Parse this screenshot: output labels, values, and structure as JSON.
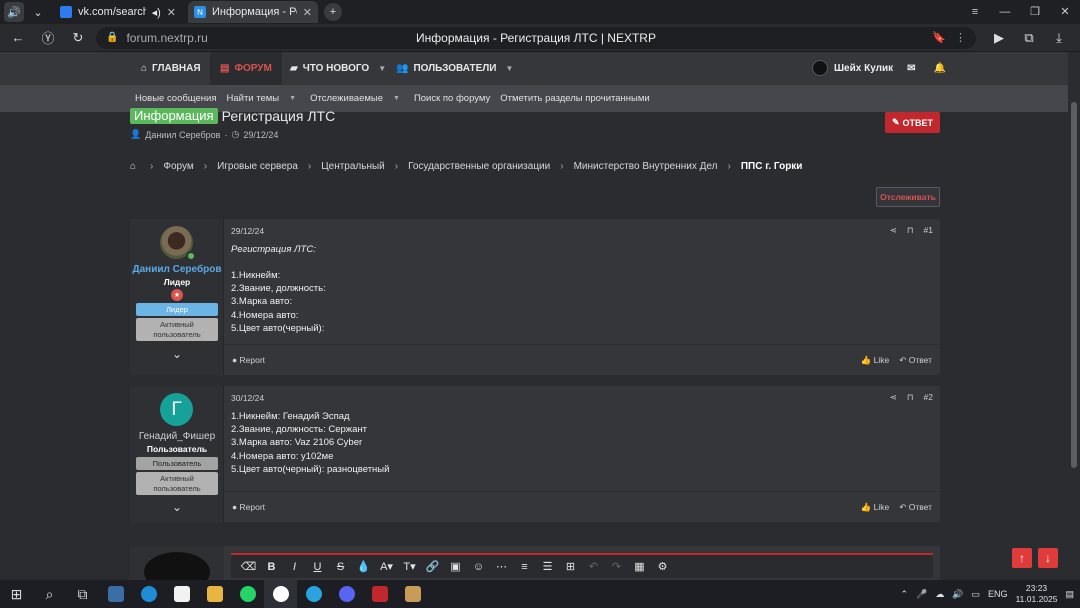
{
  "browser": {
    "tabs": [
      {
        "label": "vk.com/search/audio",
        "icon": "vk-icon"
      },
      {
        "label": "Информация - Регистр",
        "icon": "nextrp-icon"
      }
    ],
    "url": "forum.nextrp.ru",
    "page_title": "Информация - Регистрация ЛТС | NEXTRP"
  },
  "sitenav": {
    "home": "ГЛАВНАЯ",
    "forum": "ФОРУМ",
    "whats_new": "ЧТО НОВОГО",
    "users": "ПОЛЬЗОВАТЕЛИ",
    "account_name": "Шейх Кулик"
  },
  "subnav": {
    "new_messages": "Новые сообщения",
    "find_threads": "Найти темы",
    "watched": "Отслеживаемые",
    "search_forum": "Поиск по форуму",
    "mark_read": "Отметить разделы прочитанными"
  },
  "thread": {
    "prefix": "Информация",
    "title": "Регистрация ЛТС",
    "author": "Даниил Серебров",
    "date": "29/12/24",
    "reply_label": "ОТВЕТ",
    "watch_label": "Отслеживать"
  },
  "breadcrumb": [
    "Форум",
    "Игровые сервера",
    "Центральный",
    "Государственные организации",
    "Министерство Внутренних Дел",
    "ППС г. Горки"
  ],
  "posts": [
    {
      "username": "Даниил Серебров",
      "user_title": "Лидер",
      "badge1": "Лидер",
      "badge2": "Активный пользователь",
      "date": "29/12/24",
      "number": "#1",
      "heading": "Регистрация ЛТС:",
      "lines": [
        "1.Никнейм:",
        "2.Звание, должность:",
        "3.Марка авто:",
        "4.Номера авто:",
        "5.Цвет авто(черный):"
      ],
      "name_color": "#5aa9e6"
    },
    {
      "username": "Генадий_Фишер",
      "user_title": "Пользователь",
      "avatar_letter": "Г",
      "badge1": "Пользователь",
      "badge2": "Активный пользователь",
      "date": "30/12/24",
      "number": "#2",
      "lines": [
        "1.Никнейм: Генадий Эспад",
        "2.Звание, должность: Сержант",
        "3.Марка авто: Vaz 2106 Cyber",
        "4.Номера авто: у102ме",
        "5.Цвет авто(черный): разноцветный"
      ],
      "name_color": "#cfcfcf"
    }
  ],
  "post_actions": {
    "report": "Report",
    "like": "Like",
    "reply": "Ответ"
  },
  "taskbar": {
    "lang": "ENG",
    "time": "23:23",
    "date": "11.01.2025"
  },
  "colors": {
    "accent": "#c0282d",
    "prefix": "#5cb85c",
    "online": "#5cb85c"
  }
}
